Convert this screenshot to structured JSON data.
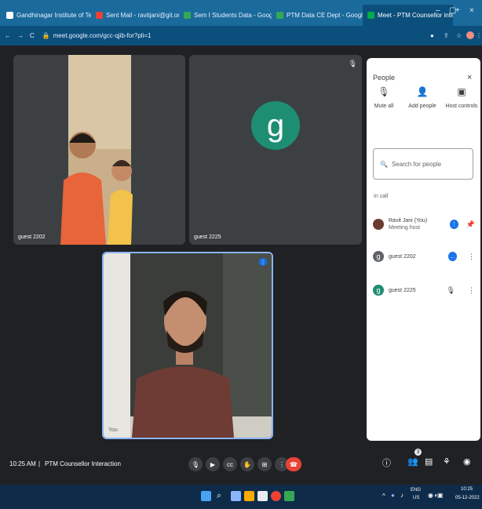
{
  "tabs": [
    {
      "title": "Gandhinagar Institute of Technol",
      "active": false
    },
    {
      "title": "Sent Mail - ravitjani@git.org.in",
      "active": false
    },
    {
      "title": "Sem I Students Data - Google S",
      "active": false
    },
    {
      "title": "PTM Data CE Dept - Google She",
      "active": false
    },
    {
      "title": "Meet - PTM Counsellor inte",
      "active": true
    }
  ],
  "address": {
    "url": "meet.google.com/gcc-qjib-for?pli=1"
  },
  "tiles": {
    "guest1": {
      "label": "guest 2202"
    },
    "guest2": {
      "label": "guest 2225",
      "initial": "g"
    },
    "self": {
      "label": "You"
    }
  },
  "panel": {
    "title": "People",
    "controls": {
      "mute_all": "Mute all",
      "add_people": "Add people",
      "host_controls": "Host controls"
    },
    "search_placeholder": "Search for people",
    "section": "In call",
    "people": [
      {
        "name": "Ravit Jani (You)",
        "sub": "Meeting host"
      },
      {
        "name": "guest 2202",
        "initial": "g"
      },
      {
        "name": "guest 2225",
        "initial": "g"
      }
    ]
  },
  "meeting": {
    "time": "10:25 AM",
    "title": "PTM Counsellor Interaction"
  },
  "taskbar": {
    "lang": "ENG",
    "region": "US",
    "time": "10:25",
    "date": "05-12-2022"
  },
  "colors": {
    "accent": "#1a73e8",
    "end_call": "#ea4335",
    "guest_avatar": "#1e8e73"
  }
}
